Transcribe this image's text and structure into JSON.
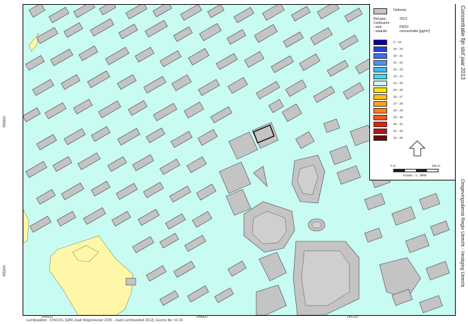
{
  "side_labels": {
    "title": "Concentratie fijn stof jaar 2013",
    "organisation": "Omgevingsdienst Regio Utrecht - Vestiging Utrecht"
  },
  "legend": {
    "building_label": "Gebouw",
    "meta": [
      {
        "label": "Ref.jaar:",
        "value": "2013"
      },
      {
        "label": "Contouren",
        "value": ""
      },
      {
        "label": "- stof:",
        "value": "PM10"
      },
      {
        "label": "- waarde:",
        "value": "concentratie [µg/m³]"
      }
    ],
    "classes": [
      {
        "label": "0 - 18",
        "color": "#0000b4"
      },
      {
        "label": "18 - 20",
        "color": "#2b3fd8"
      },
      {
        "label": "20 - 21",
        "color": "#3f6cf0"
      },
      {
        "label": "21 - 22",
        "color": "#4f92f6"
      },
      {
        "label": "22 - 23",
        "color": "#3fb9f2"
      },
      {
        "label": "23 - 24",
        "color": "#43d6ec"
      },
      {
        "label": "24 - 25",
        "color": "#c8fbf1"
      },
      {
        "label": "25 - 26",
        "color": "#ffe400"
      },
      {
        "label": "26 - 27",
        "color": "#ffc21a"
      },
      {
        "label": "27 - 28",
        "color": "#ffa21e"
      },
      {
        "label": "28 - 29",
        "color": "#ff7e1e"
      },
      {
        "label": "29 - 30",
        "color": "#f05818"
      },
      {
        "label": "30 - 31",
        "color": "#e02010"
      },
      {
        "label": "31 - 33",
        "color": "#b41414"
      },
      {
        "label": "33 - 99",
        "color": "#6a0a0a"
      }
    ],
    "scale_start": "0 m",
    "scale_end": "100 m",
    "scale_text": "schaal = 1 : 3999"
  },
  "coordinates": {
    "left": [
      "455600",
      "455200"
    ],
    "bottom": [
      "144600",
      "144800",
      "145200"
    ]
  },
  "footer": "Luchtkwaliteit - STACKS, [GBK Zaalt Wegenviewer 2005 - Zaalt Luchtkwaliteit 2012], Geoms lite: V2.30",
  "colors": {
    "background_class": "#c8fbf1",
    "building": "#c4c4c4",
    "yellow_area": "#fff7a8"
  }
}
